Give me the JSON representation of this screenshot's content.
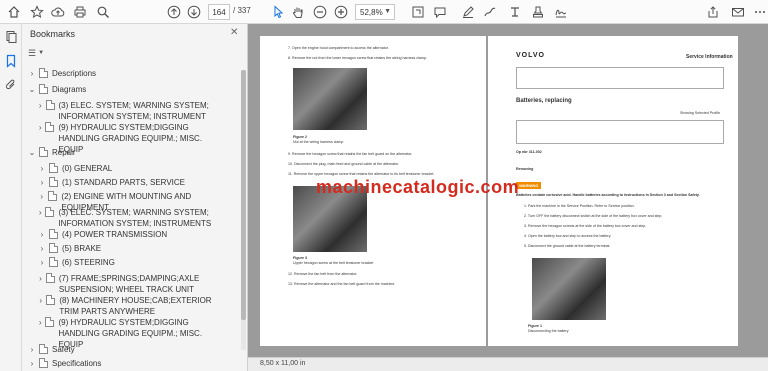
{
  "toolbar": {
    "page_current": "164",
    "page_total": "/ 337",
    "zoom": "52,8%"
  },
  "bookmarks_panel": {
    "title": "Bookmarks",
    "items": [
      {
        "label": "Descriptions",
        "level": 0,
        "expanded": false
      },
      {
        "label": "Diagrams",
        "level": 0,
        "expanded": true
      },
      {
        "label": "(3) ELEC. SYSTEM; WARNING SYSTEM; INFORMATION SYSTEM; INSTRUMENT",
        "level": 1,
        "expanded": false
      },
      {
        "label": "(9) HYDRAULIC SYSTEM;DIGGING HANDLING GRADING EQUIPM.; MISC. EQUIP",
        "level": 1,
        "expanded": false
      },
      {
        "label": "Repair",
        "level": 0,
        "expanded": true
      },
      {
        "label": "(0) GENERAL",
        "level": 1,
        "expanded": false
      },
      {
        "label": "(1) STANDARD PARTS, SERVICE",
        "level": 1,
        "expanded": false
      },
      {
        "label": "(2) ENGINE WITH MOUNTING AND EQUIPMENT",
        "level": 1,
        "expanded": false
      },
      {
        "label": "(3) ELEC. SYSTEM; WARNING SYSTEM; INFORMATION SYSTEM; INSTRUMENTS",
        "level": 1,
        "expanded": false
      },
      {
        "label": "(4) POWER TRANSMISSION",
        "level": 1,
        "expanded": false
      },
      {
        "label": "(5) BRAKE",
        "level": 1,
        "expanded": false
      },
      {
        "label": "(6) STEERING",
        "level": 1,
        "expanded": false
      },
      {
        "label": "(7) FRAME;SPRINGS;DAMPING;AXLE SUSPENSION; WHEEL TRACK UNIT",
        "level": 1,
        "expanded": false
      },
      {
        "label": "(8) MACHINERY HOUSE;CAB;EXTERIOR TRIM PARTS ANYWHERE",
        "level": 1,
        "expanded": false
      },
      {
        "label": "(9) HYDRAULIC SYSTEM;DIGGING HANDLING GRADING EQUIPM.; MISC. EQUIP",
        "level": 1,
        "expanded": false
      },
      {
        "label": "Safety",
        "level": 0,
        "expanded": false
      },
      {
        "label": "Specifications",
        "level": 0,
        "expanded": false
      }
    ]
  },
  "left_page": {
    "lines": [
      "7.  Open the engine hood compartment to access the alternator.",
      "8.  Remove the nut from the lower hexagon screw that retains the wiring harness clamp.",
      "Figure 2",
      "Nut at the wiring harness clamp",
      "9.  Remove the hexagon screw that retains the fan belt guard on the alternator.",
      "10. Disconnect the plug, main feed and ground cable at the alternator.",
      "11. Remove the upper hexagon screw that retains the alternator to its belt tensioner bracket.",
      "Figure 3",
      "Upper hexagon screw at the belt tensioner bracket",
      "12. Remove the fan belt from the alternator.",
      "13. Remove the alternator and the fan belt guard from the machine."
    ]
  },
  "right_page": {
    "logo": "VOLVO",
    "header_title": "Service Information",
    "doc_title": "Batteries, replacing",
    "profile_note": "Showing Selected Profile",
    "op_no": "Op nbr 311-002",
    "removing": "Removing",
    "warning": "WARNING",
    "warning_text": "Batteries contain corrosive acid. Handle batteries according to instructions in Section 3 and Section Safety.",
    "steps": [
      "1.  Park the machine in the Service Position. Refer to Service position.",
      "2.  Turn OFF the battery disconnect switch at the side of the battery box cover and step.",
      "3.  Remove the hexagon screws at the side of the battery box cover and step.",
      "4.  Open the battery box and step to access the battery.",
      "5.  Disconnect the ground cable at the battery terminal."
    ],
    "figure_caption": "Figure 1",
    "figure_sub": "Disconnecting the battery"
  },
  "watermark": "machinecatalogic.com",
  "status_bar": {
    "page_size": "8,50 x 11,00 in"
  }
}
